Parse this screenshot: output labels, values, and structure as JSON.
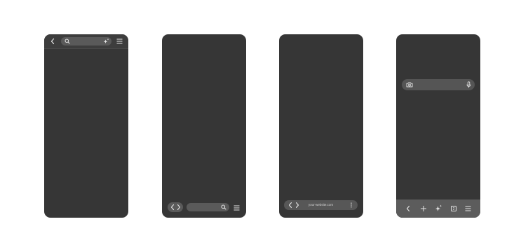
{
  "colors": {
    "page_background": "#ffffff",
    "phone_body": "#363636",
    "pill": "#5a5a5a",
    "bottom_bar": "#5c5c5c",
    "icon": "#e6e6e6"
  },
  "phone1": {
    "icons": [
      "chevron-left-icon",
      "search-icon",
      "sparkle-icon",
      "menu-icon"
    ]
  },
  "phone2": {
    "icons": [
      "chevron-left-icon",
      "chevron-right-icon",
      "search-icon",
      "menu-icon"
    ]
  },
  "phone3": {
    "url": "your-website.com",
    "icons": [
      "chevron-left-icon",
      "chevron-right-icon",
      "more-vertical-icon"
    ]
  },
  "phone4": {
    "tab_count": "2",
    "icons": [
      "camera-icon",
      "microphone-icon",
      "chevron-left-icon",
      "plus-icon",
      "sparkle-icon",
      "tab-count-icon",
      "menu-icon"
    ]
  }
}
